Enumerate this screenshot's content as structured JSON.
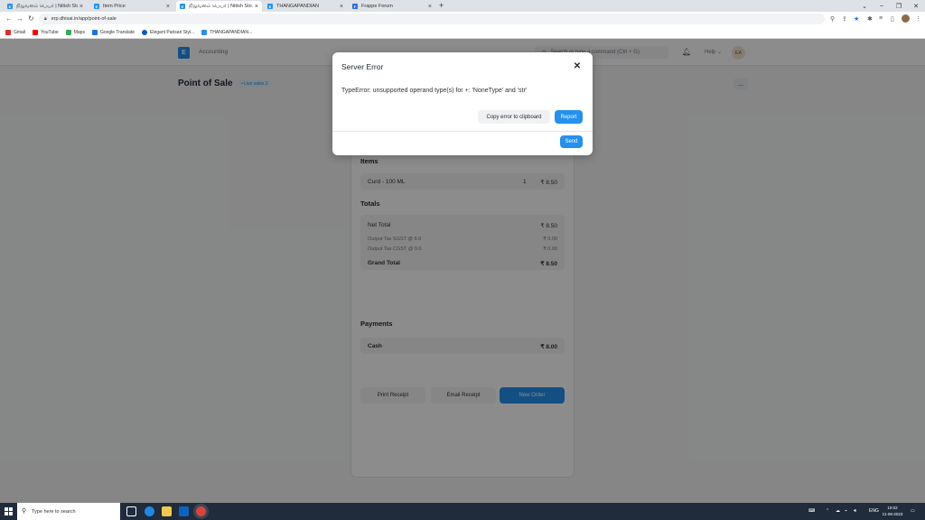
{
  "browser": {
    "tabs": [
      {
        "title": "நிறுவனம் பெயர் | Nitish Sto...",
        "fav_color": "#2490ef",
        "fav": "E"
      },
      {
        "title": "Item Price",
        "fav_color": "#2490ef",
        "fav": "E"
      },
      {
        "title": "நிறுவனம் பெயர் | Nitish Sto...",
        "fav_color": "#2490ef",
        "fav": "E"
      },
      {
        "title": "THANGAPANDIAN",
        "fav_color": "#2490ef",
        "fav": "E"
      },
      {
        "title": "Frappe Forum",
        "fav_color": "#2a6ee0",
        "fav": "F"
      }
    ],
    "new_tab": "+",
    "url": "erp.dhisai.in/app/point-of-sale",
    "bookmarks": [
      {
        "label": "Gmail",
        "color": "#d93025"
      },
      {
        "label": "YouTube",
        "color": "#ff0000"
      },
      {
        "label": "Maps",
        "color": "#34a853"
      },
      {
        "label": "Google Translate",
        "color": "#1a73e8"
      },
      {
        "label": "Elegant Parisari Styl...",
        "color": "#0b57d0"
      },
      {
        "label": "THANGAPANDIAN...",
        "color": "#2490ef"
      }
    ]
  },
  "app": {
    "logo": "E",
    "breadcrumb": "Accounting",
    "search_placeholder": "Search or type a command (Ctrl + G)",
    "help": "Help",
    "avatar": "EA",
    "page_title": "Point of Sale",
    "status_badge": "Live sales 2",
    "more": "...",
    "items_heading": "Items",
    "item": {
      "name": "Curd - 100 ML",
      "qty": "1",
      "amount": "₹ 8.50"
    },
    "totals_heading": "Totals",
    "net_total_label": "Net Total",
    "net_total": "₹ 8.50",
    "sgst_label": "Output Tax SGST @ 9.0",
    "sgst": "₹ 0.00",
    "cgst_label": "Output Tax CGST @ 9.0",
    "cgst": "₹ 0.00",
    "grand_total_label": "Grand Total",
    "grand_total": "₹ 8.50",
    "payments_heading": "Payments",
    "cash_label": "Cash",
    "cash": "₹ 8.00",
    "print_receipt": "Print Receipt",
    "email_receipt": "Email Receipt",
    "new_order": "New Order"
  },
  "modal": {
    "title": "Server Error",
    "close": "✕",
    "message": "TypeError: unsupported operand type(s) for +: 'NoneType' and 'str'",
    "copy_button": "Copy error to clipboard",
    "report_button": "Report",
    "send_button": "Send"
  },
  "taskbar": {
    "search_placeholder": "Type here to search",
    "lang": "ENG",
    "time": "10:02",
    "date": "11-08-2023"
  },
  "colors": {
    "primary": "#2490ef",
    "taskbar": "#202b3b"
  }
}
